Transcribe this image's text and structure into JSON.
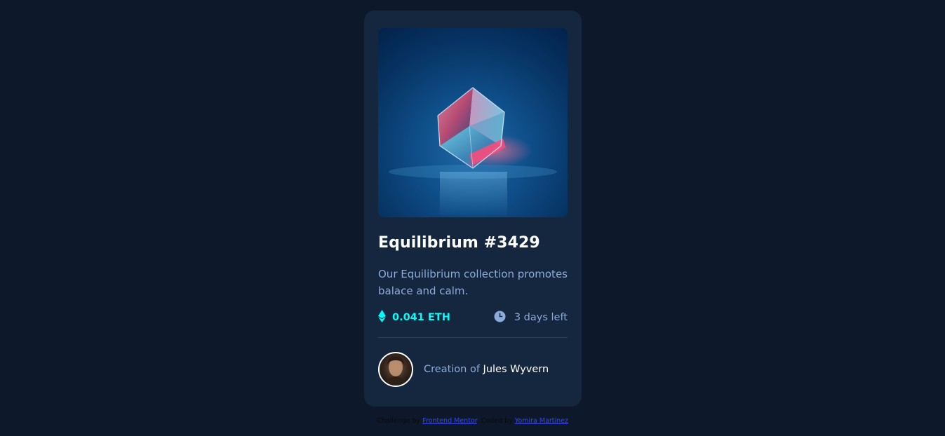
{
  "card": {
    "title": "Equilibrium #3429",
    "description": "Our Equilibrium collection promotes balace and calm.",
    "price": "0.041 ETH",
    "time_left": "3 days left",
    "creator_prefix": "Creation of ",
    "creator_name": "Jules Wyvern"
  },
  "footer": {
    "challenge_prefix": "Challenge by ",
    "challenge_link": "Frontend Mentor",
    "coded_prefix": ". Coded by ",
    "coded_link": "Yomira Martinez"
  },
  "icons": {
    "price": "ethereum-icon",
    "time": "clock-icon"
  },
  "colors": {
    "page_bg": "#0d192b",
    "card_bg": "#15263f",
    "cyan": "#00fff8",
    "soft_blue": "#8bacd9",
    "white": "#ffffff"
  }
}
